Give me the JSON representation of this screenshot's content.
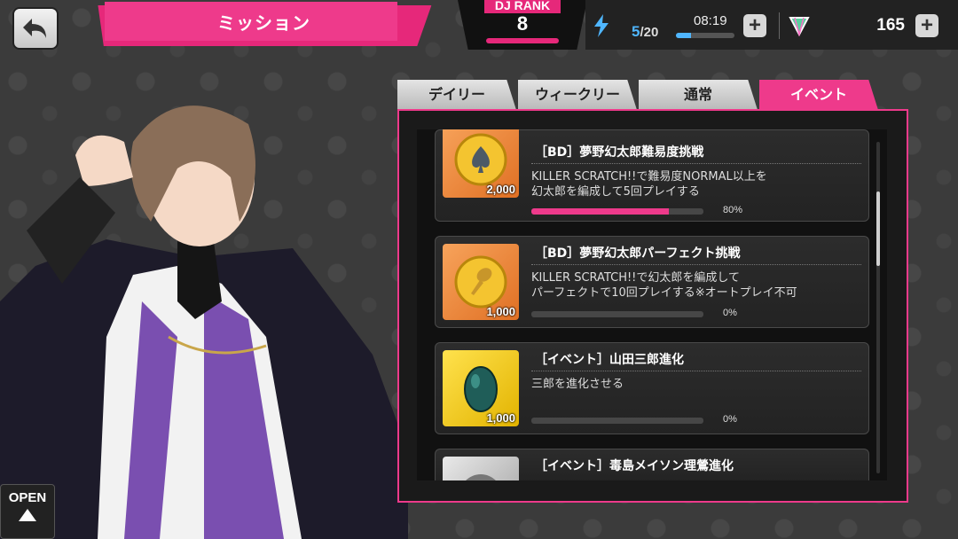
{
  "header": {
    "title": "ミッション",
    "dj_rank_label": "DJ RANK",
    "dj_rank_value": "8",
    "stamina_current": "5",
    "stamina_max": "/20",
    "stamina_progress": 0.25,
    "timer": "08:19",
    "gems": "165",
    "plus": "+"
  },
  "tabs": [
    {
      "label": "デイリー",
      "active": false
    },
    {
      "label": "ウィークリー",
      "active": false
    },
    {
      "label": "通常",
      "active": false
    },
    {
      "label": "イベント",
      "active": true
    }
  ],
  "missions": [
    {
      "title": "［BD］夢野幻太郎難易度挑戦",
      "description": "KILLER SCRATCH!!で難易度NORMAL以上を\n幻太郎を編成して5回プレイする",
      "reward_qty": "2,000",
      "reward_icon": "spade-coin-icon",
      "progress": 0.8,
      "progress_text": "80%"
    },
    {
      "title": "［BD］夢野幻太郎パーフェクト挑戦",
      "description": "KILLER SCRATCH!!で幻太郎を編成して\nパーフェクトで10回プレイする※オートプレイ不可",
      "reward_qty": "1,000",
      "reward_icon": "microphone-coin-icon",
      "progress": 0,
      "progress_text": "0%"
    },
    {
      "title": "［イベント］山田三郎進化",
      "description": "三郎を進化させる",
      "reward_qty": "1,000",
      "reward_icon": "green-gem-egg-icon",
      "progress": 0,
      "progress_text": "0%"
    },
    {
      "title": "［イベント］毒島メイソン理鶯進化",
      "description": "",
      "reward_qty": "",
      "reward_icon": "silver-item-icon",
      "progress": 0,
      "progress_text": ""
    }
  ],
  "open_button": "OPEN",
  "colors": {
    "accent": "#ee3a8b",
    "stamina": "#4fb6ff"
  }
}
